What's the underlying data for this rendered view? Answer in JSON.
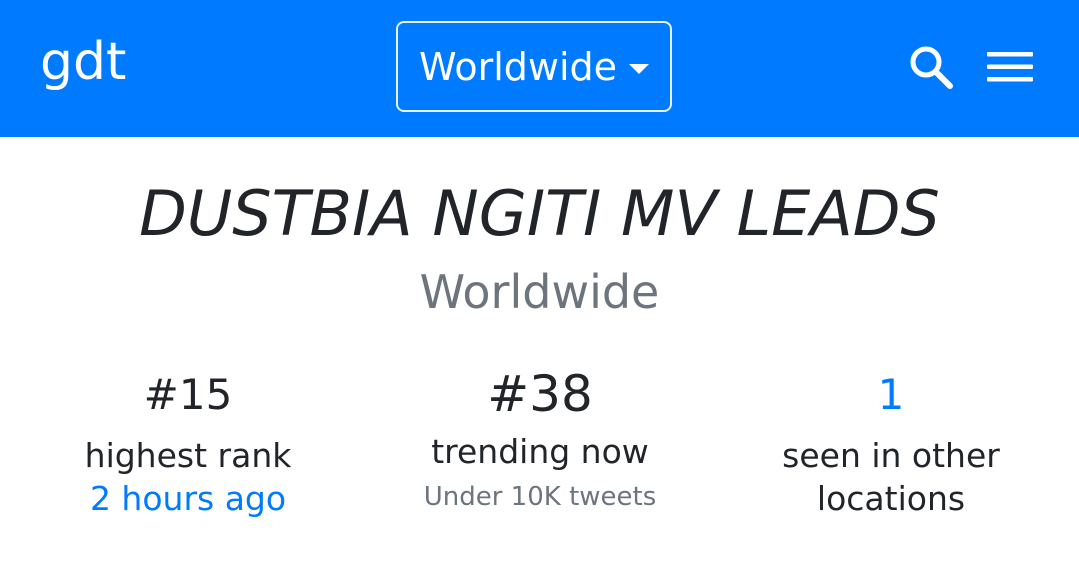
{
  "navbar": {
    "brand": "gdt",
    "location_dropdown": "Worldwide",
    "search_icon": "search-icon",
    "menu_icon": "hamburger-menu-icon",
    "background_color": "#007bff"
  },
  "trend": {
    "title": "DUSTBIA NGITI MV LEADS",
    "location": "Worldwide"
  },
  "stats": {
    "highest_rank": {
      "value": "#15",
      "label": "highest rank",
      "when": "2 hours ago"
    },
    "trending_now": {
      "value": "#38",
      "label": "trending now",
      "volume": "Under 10K tweets"
    },
    "other_locations": {
      "value": "1",
      "label": "seen in other locations"
    }
  },
  "colors": {
    "accent": "#007bff",
    "muted": "#6c757d",
    "text": "#212529"
  }
}
